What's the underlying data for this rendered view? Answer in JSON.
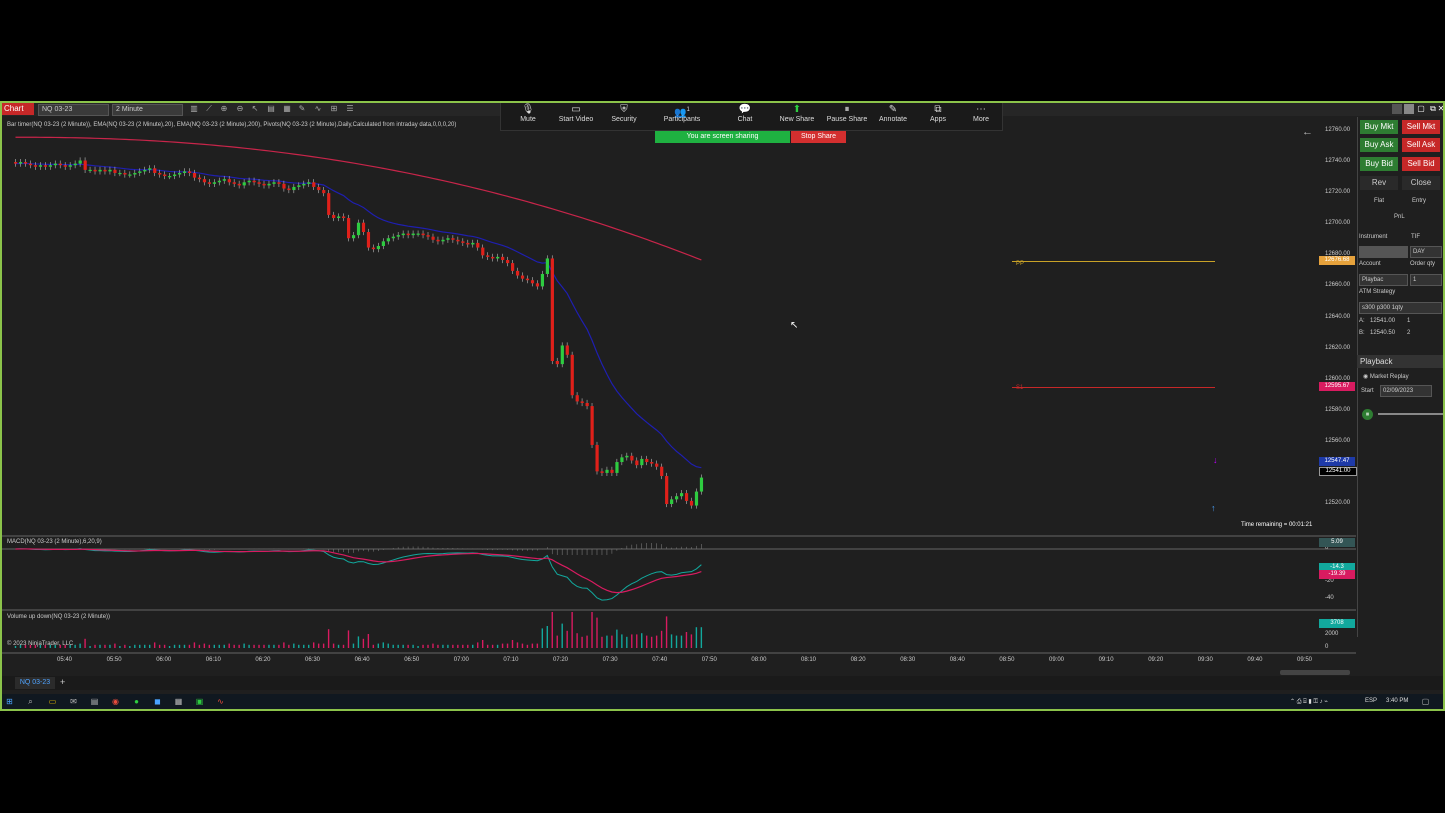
{
  "window": {
    "chart_tab": "Chart",
    "instrument_select": "NQ 03-23",
    "interval_select": "2 Minute"
  },
  "zoom": {
    "items": [
      {
        "label": "Mute",
        "icon": "microphone-icon"
      },
      {
        "label": "Start Video",
        "icon": "video-off-icon"
      },
      {
        "label": "Security",
        "icon": "shield-icon"
      },
      {
        "label": "Participants",
        "icon": "participants-icon",
        "count": "1"
      },
      {
        "label": "Chat",
        "icon": "chat-icon"
      },
      {
        "label": "New Share",
        "icon": "share-icon"
      },
      {
        "label": "Pause Share",
        "icon": "pause-icon"
      },
      {
        "label": "Annotate",
        "icon": "pen-icon"
      },
      {
        "label": "Apps",
        "icon": "apps-icon"
      },
      {
        "label": "More",
        "icon": "more-icon"
      }
    ],
    "sharing_text": "You are screen sharing",
    "stop_share": "Stop Share",
    "colors": {
      "share_green": "#1fb141",
      "stop_red": "#d32f2f"
    }
  },
  "main_chart": {
    "indicator_line": "Bar timer(NQ 03-23 (2 Minute)), EMA(NQ 03-23 (2 Minute),20), EMA(NQ 03-23 (2 Minute),200), Pivots(NQ 03-23 (2 Minute),Daily,Calculated from intraday data,0,0,0,20)",
    "time_remaining": "Time remaining = 00:01:21",
    "pivot_pp": "PP",
    "pivot_s1": "S1",
    "price_labels": [
      "12760.00",
      "12740.00",
      "12720.00",
      "12700.00",
      "12680.00",
      "12660.00",
      "12640.00",
      "12620.00",
      "12600.00",
      "12580.00",
      "12560.00",
      "12540.00",
      "12520.00"
    ],
    "badges": [
      {
        "text": "12676.68",
        "color": "#e6a23c",
        "price": 12676.68
      },
      {
        "text": "12595.67",
        "color": "#d81b60",
        "price": 12595.67
      },
      {
        "text": "12547.47",
        "color": "#1e3aa8",
        "price": 12547.47
      },
      {
        "text": "12541.00",
        "color": "#000000",
        "price": 12541.0
      }
    ]
  },
  "macd": {
    "label": "MACD(NQ 03-23 (2 Minute),6,20,9)",
    "axis": [
      "0",
      "-20",
      "-40"
    ],
    "badges": [
      "5.09",
      "-14.3",
      "-19.39"
    ]
  },
  "volume": {
    "label": "Volume up down(NQ 03-23 (2 Minute))",
    "copyright": "© 2023 NinjaTrader, LLC",
    "axis": [
      "2000",
      "0"
    ],
    "badge": "3708"
  },
  "time_labels": [
    "05:40",
    "05:50",
    "06:00",
    "06:10",
    "06:20",
    "06:30",
    "06:40",
    "06:50",
    "07:00",
    "07:10",
    "07:20",
    "07:30",
    "07:40",
    "07:50",
    "08:00",
    "08:10",
    "08:20",
    "08:30",
    "08:40",
    "08:50",
    "09:00",
    "09:10",
    "09:20",
    "09:30",
    "09:40",
    "09:50"
  ],
  "panel": {
    "buy_mkt": "Buy Mkt",
    "sell_mkt": "Sell Mkt",
    "buy_ask": "Buy Ask",
    "sell_ask": "Sell Ask",
    "buy_bid": "Buy Bid",
    "sell_bid": "Sell Bid",
    "rev": "Rev",
    "close": "Close",
    "flat": "Flat",
    "entry": "Entry",
    "pnl": "PnL",
    "instrument_label": "Instrument",
    "tif_label": "TIF",
    "tif_value": "DAY",
    "account_label": "Account",
    "order_qty_label": "Order qty",
    "account_value": "Playbac",
    "order_qty_value": "1",
    "atm_label": "ATM Strategy",
    "atm_value": "s300 p300 1qty",
    "a_label": "A:",
    "a_price": "12541.00",
    "a_qty": "1",
    "b_label": "B:",
    "b_price": "12540.50",
    "b_qty": "2",
    "playback_title": "Playback",
    "market_replay": "Market Replay",
    "start_label": "Start",
    "start_value": "02/09/2023"
  },
  "bottom_tab": "NQ 03-23",
  "taskbar": {
    "lang": "ESP",
    "clock": "3:40 PM"
  },
  "chart_data": {
    "type": "candlestick",
    "price_range": [
      12510,
      12770
    ],
    "ema20_color": "#1f1fb0",
    "ema200_color": "#c8254a",
    "up_color": "#2ecc40",
    "down_color": "#e0201a",
    "pp": 12676,
    "s1": 12595,
    "closes": [
      12739,
      12740,
      12739,
      12738,
      12737,
      12738,
      12737,
      12738,
      12739,
      12738,
      12737,
      12738,
      12739,
      12741,
      12735,
      12735,
      12734,
      12735,
      12734,
      12735,
      12733,
      12733,
      12732,
      12732,
      12733,
      12734,
      12735,
      12736,
      12733,
      12732,
      12731,
      12731,
      12732,
      12733,
      12734,
      12733,
      12730,
      12729,
      12727,
      12726,
      12727,
      12728,
      12729,
      12727,
      12726,
      12725,
      12727,
      12728,
      12727,
      12726,
      12725,
      12726,
      12727,
      12726,
      12723,
      12722,
      12724,
      12725,
      12726,
      12727,
      12724,
      12722,
      12720,
      12706,
      12704,
      12705,
      12704,
      12691,
      12693,
      12701,
      12695,
      12685,
      12684,
      12686,
      12689,
      12691,
      12692,
      12693,
      12694,
      12693,
      12694,
      12694,
      12693,
      12692,
      12690,
      12689,
      12690,
      12691,
      12690,
      12689,
      12688,
      12687,
      12688,
      12685,
      12680,
      12679,
      12678,
      12679,
      12677,
      12675,
      12670,
      12667,
      12665,
      12664,
      12662,
      12660,
      12668,
      12678,
      12612,
      12610,
      12622,
      12616,
      12590,
      12586,
      12585,
      12583,
      12558,
      12541,
      12540,
      12542,
      12540,
      12547,
      12550,
      12551,
      12548,
      12545,
      12549,
      12547,
      12546,
      12544,
      12538,
      12520,
      12523,
      12525,
      12527,
      12522,
      12519,
      12528,
      12537
    ]
  }
}
